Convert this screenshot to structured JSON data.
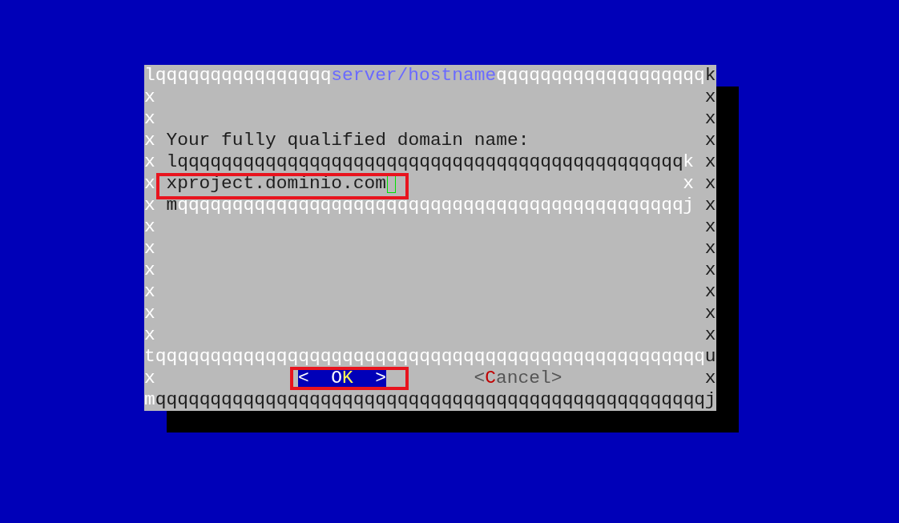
{
  "dialog": {
    "top_border": {
      "corner_left": "l",
      "fill_left": "qqqqqqqqqqqqqqqq",
      "title": "server/hostname",
      "fill_right": "qqqqqqqqqqqqqqqqqqq",
      "corner_right": "k"
    },
    "rows": [
      {
        "kind": "blank",
        "left": "x",
        "right": "x"
      },
      {
        "kind": "blank",
        "left": "x",
        "right": "x"
      },
      {
        "kind": "prompt",
        "left": "x",
        "text": "Your fully qualified domain name:",
        "right": "x"
      },
      {
        "kind": "field_top",
        "left": "x",
        "inner_left": "l",
        "inner_fill": "qqqqqqqqqqqqqqqqqqqqqqqqqqqqqqqqqqqqqqqqqqqqqq",
        "inner_right": "k",
        "right": "x"
      },
      {
        "kind": "field",
        "left": "x",
        "inner_left": "x",
        "value": "project.dominio.com",
        "highlighted": true,
        "inner_right": "x",
        "right": "x"
      },
      {
        "kind": "field_bottom",
        "left": "x",
        "inner_left": "m",
        "inner_fill": "qqqqqqqqqqqqqqqqqqqqqqqqqqqqqqqqqqqqqqqqqqqqqq",
        "inner_right": "j",
        "right": "x"
      },
      {
        "kind": "blank",
        "left": "x",
        "right": "x"
      },
      {
        "kind": "blank",
        "left": "x",
        "right": "x"
      },
      {
        "kind": "blank",
        "left": "x",
        "right": "x"
      },
      {
        "kind": "blank",
        "left": "x",
        "right": "x"
      },
      {
        "kind": "blank",
        "left": "x",
        "right": "x"
      },
      {
        "kind": "blank",
        "left": "x",
        "right": "x"
      }
    ],
    "separator": {
      "left": "t",
      "fill": "qqqqqqqqqqqqqqqqqqqqqqqqqqqqqqqqqqqqqqqqqqqqqqqqqq",
      "right": "u"
    },
    "button_row": {
      "left": "x",
      "right": "x"
    },
    "buttons": [
      {
        "selected": true,
        "highlighted": true,
        "parts": [
          {
            "kind": "plain",
            "text": "<  O"
          },
          {
            "kind": "hotkey",
            "text": "K"
          },
          {
            "kind": "plain",
            "text": "  >"
          }
        ]
      },
      {
        "selected": false,
        "highlighted": false,
        "parts": [
          {
            "kind": "plain",
            "text": "<"
          },
          {
            "kind": "hotkey",
            "text": "C"
          },
          {
            "kind": "plain",
            "text": "ancel>"
          }
        ]
      }
    ],
    "bottom_border": {
      "left": "m",
      "fill": "qqqqqqqqqqqqqqqqqqqqqqqqqqqqqqqqqqqqqqqqqqqqqqqqqq",
      "right": "j"
    }
  }
}
